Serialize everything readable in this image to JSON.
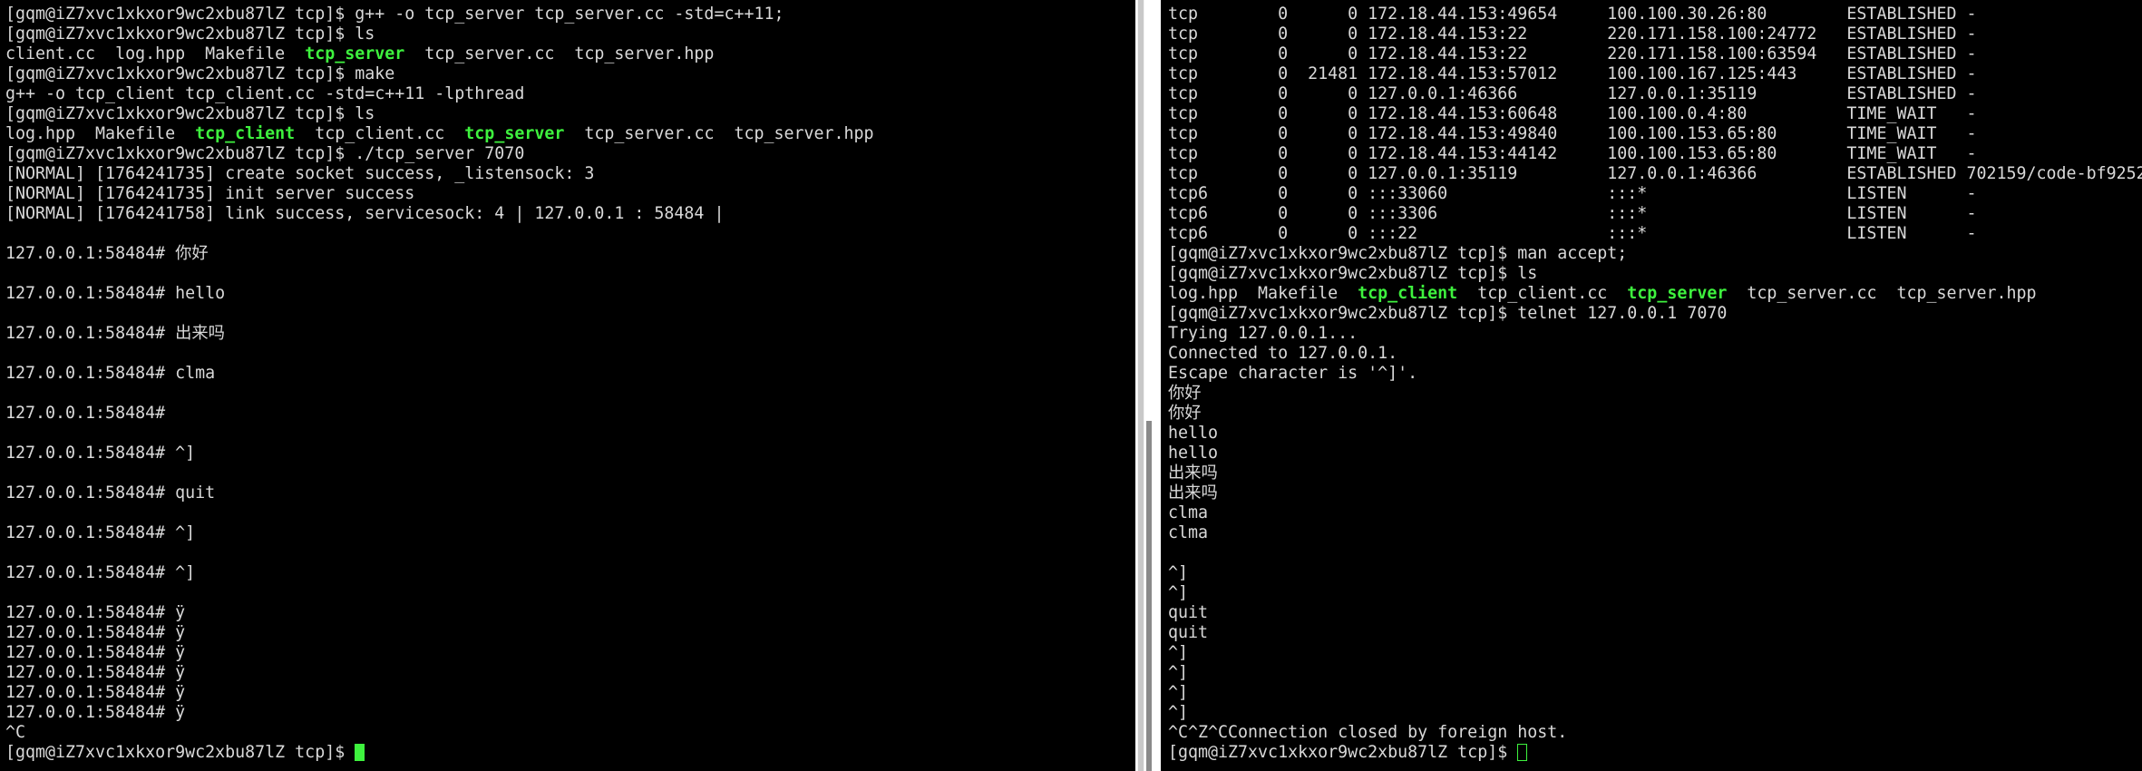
{
  "colors": {
    "background": "#000000",
    "text": "#d9d9d9",
    "executable": "#3ef23e",
    "cursor": "#3ef23e",
    "divider": "#ffffff"
  },
  "left_terminal": {
    "lines": [
      [
        {
          "t": "[gqm@iZ7xvc1xkxor9wc2xbu87lZ tcp]$ g++ -o tcp_server tcp_server.cc -std=c++11;",
          "k": "normal"
        }
      ],
      [
        {
          "t": "[gqm@iZ7xvc1xkxor9wc2xbu87lZ tcp]$ ls",
          "k": "normal"
        }
      ],
      [
        {
          "t": "client.cc  log.hpp  Makefile  ",
          "k": "normal"
        },
        {
          "t": "tcp_server",
          "k": "exec"
        },
        {
          "t": "  tcp_server.cc  tcp_server.hpp",
          "k": "normal"
        }
      ],
      [
        {
          "t": "[gqm@iZ7xvc1xkxor9wc2xbu87lZ tcp]$ make",
          "k": "normal"
        }
      ],
      [
        {
          "t": "g++ -o tcp_client tcp_client.cc -std=c++11 -lpthread",
          "k": "normal"
        }
      ],
      [
        {
          "t": "[gqm@iZ7xvc1xkxor9wc2xbu87lZ tcp]$ ls",
          "k": "normal"
        }
      ],
      [
        {
          "t": "log.hpp  Makefile  ",
          "k": "normal"
        },
        {
          "t": "tcp_client",
          "k": "exec"
        },
        {
          "t": "  tcp_client.cc  ",
          "k": "normal"
        },
        {
          "t": "tcp_server",
          "k": "exec"
        },
        {
          "t": "  tcp_server.cc  tcp_server.hpp",
          "k": "normal"
        }
      ],
      [
        {
          "t": "[gqm@iZ7xvc1xkxor9wc2xbu87lZ tcp]$ ./tcp_server 7070",
          "k": "normal"
        }
      ],
      [
        {
          "t": "[NORMAL] [1764241735] create socket success, _listensock: 3",
          "k": "normal"
        }
      ],
      [
        {
          "t": "[NORMAL] [1764241735] init server success",
          "k": "normal"
        }
      ],
      [
        {
          "t": "[NORMAL] [1764241758] link success, servicesock: 4 | 127.0.0.1 : 58484 |",
          "k": "normal"
        }
      ],
      [
        {
          "t": "",
          "k": "normal"
        }
      ],
      [
        {
          "t": "127.0.0.1:58484# 你好",
          "k": "normal"
        }
      ],
      [
        {
          "t": "",
          "k": "normal"
        }
      ],
      [
        {
          "t": "127.0.0.1:58484# hello",
          "k": "normal"
        }
      ],
      [
        {
          "t": "",
          "k": "normal"
        }
      ],
      [
        {
          "t": "127.0.0.1:58484# 出来吗",
          "k": "normal"
        }
      ],
      [
        {
          "t": "",
          "k": "normal"
        }
      ],
      [
        {
          "t": "127.0.0.1:58484# clma",
          "k": "normal"
        }
      ],
      [
        {
          "t": "",
          "k": "normal"
        }
      ],
      [
        {
          "t": "127.0.0.1:58484#",
          "k": "normal"
        }
      ],
      [
        {
          "t": "",
          "k": "normal"
        }
      ],
      [
        {
          "t": "127.0.0.1:58484# ^]",
          "k": "normal"
        }
      ],
      [
        {
          "t": "",
          "k": "normal"
        }
      ],
      [
        {
          "t": "127.0.0.1:58484# quit",
          "k": "normal"
        }
      ],
      [
        {
          "t": "",
          "k": "normal"
        }
      ],
      [
        {
          "t": "127.0.0.1:58484# ^]",
          "k": "normal"
        }
      ],
      [
        {
          "t": "",
          "k": "normal"
        }
      ],
      [
        {
          "t": "127.0.0.1:58484# ^]",
          "k": "normal"
        }
      ],
      [
        {
          "t": "",
          "k": "normal"
        }
      ],
      [
        {
          "t": "127.0.0.1:58484# ÿ",
          "k": "normal"
        }
      ],
      [
        {
          "t": "127.0.0.1:58484# ÿ",
          "k": "normal"
        }
      ],
      [
        {
          "t": "127.0.0.1:58484# ÿ",
          "k": "normal"
        }
      ],
      [
        {
          "t": "127.0.0.1:58484# ÿ",
          "k": "normal"
        }
      ],
      [
        {
          "t": "127.0.0.1:58484# ÿ",
          "k": "normal"
        }
      ],
      [
        {
          "t": "127.0.0.1:58484# ÿ",
          "k": "normal"
        }
      ],
      [
        {
          "t": "^C",
          "k": "normal"
        }
      ],
      [
        {
          "t": "[gqm@iZ7xvc1xkxor9wc2xbu87lZ tcp]$ ",
          "k": "normal"
        },
        {
          "t": "",
          "k": "cursor-block"
        }
      ]
    ]
  },
  "right_terminal": {
    "lines": [
      [
        {
          "t": "tcp        0      0 172.18.44.153:49654     100.100.30.26:80        ESTABLISHED -",
          "k": "normal"
        }
      ],
      [
        {
          "t": "tcp        0      0 172.18.44.153:22        220.171.158.100:24772   ESTABLISHED -",
          "k": "normal"
        }
      ],
      [
        {
          "t": "tcp        0      0 172.18.44.153:22        220.171.158.100:63594   ESTABLISHED -",
          "k": "normal"
        }
      ],
      [
        {
          "t": "tcp        0  21481 172.18.44.153:57012     100.100.167.125:443     ESTABLISHED -",
          "k": "normal"
        }
      ],
      [
        {
          "t": "tcp        0      0 127.0.0.1:46366         127.0.0.1:35119         ESTABLISHED -",
          "k": "normal"
        }
      ],
      [
        {
          "t": "tcp        0      0 172.18.44.153:60648     100.100.0.4:80          TIME_WAIT   -",
          "k": "normal"
        }
      ],
      [
        {
          "t": "tcp        0      0 172.18.44.153:49840     100.100.153.65:80       TIME_WAIT   -",
          "k": "normal"
        }
      ],
      [
        {
          "t": "tcp        0      0 172.18.44.153:44142     100.100.153.65:80       TIME_WAIT   -",
          "k": "normal"
        }
      ],
      [
        {
          "t": "tcp        0      0 127.0.0.1:35119         127.0.0.1:46366         ESTABLISHED 702159/code-bf9252",
          "k": "normal"
        }
      ],
      [
        {
          "t": "tcp6       0      0 :::33060                :::*                    LISTEN      -",
          "k": "normal"
        }
      ],
      [
        {
          "t": "tcp6       0      0 :::3306                 :::*                    LISTEN      -",
          "k": "normal"
        }
      ],
      [
        {
          "t": "tcp6       0      0 :::22                   :::*                    LISTEN      -",
          "k": "normal"
        }
      ],
      [
        {
          "t": "[gqm@iZ7xvc1xkxor9wc2xbu87lZ tcp]$ man accept;",
          "k": "normal"
        }
      ],
      [
        {
          "t": "[gqm@iZ7xvc1xkxor9wc2xbu87lZ tcp]$ ls",
          "k": "normal"
        }
      ],
      [
        {
          "t": "log.hpp  Makefile  ",
          "k": "normal"
        },
        {
          "t": "tcp_client",
          "k": "exec"
        },
        {
          "t": "  tcp_client.cc  ",
          "k": "normal"
        },
        {
          "t": "tcp_server",
          "k": "exec"
        },
        {
          "t": "  tcp_server.cc  tcp_server.hpp",
          "k": "normal"
        }
      ],
      [
        {
          "t": "[gqm@iZ7xvc1xkxor9wc2xbu87lZ tcp]$ telnet 127.0.0.1 7070",
          "k": "normal"
        }
      ],
      [
        {
          "t": "Trying 127.0.0.1...",
          "k": "normal"
        }
      ],
      [
        {
          "t": "Connected to 127.0.0.1.",
          "k": "normal"
        }
      ],
      [
        {
          "t": "Escape character is '^]'.",
          "k": "normal"
        }
      ],
      [
        {
          "t": "你好",
          "k": "normal"
        }
      ],
      [
        {
          "t": "你好",
          "k": "normal"
        }
      ],
      [
        {
          "t": "hello",
          "k": "normal"
        }
      ],
      [
        {
          "t": "hello",
          "k": "normal"
        }
      ],
      [
        {
          "t": "出来吗",
          "k": "normal"
        }
      ],
      [
        {
          "t": "出来吗",
          "k": "normal"
        }
      ],
      [
        {
          "t": "clma",
          "k": "normal"
        }
      ],
      [
        {
          "t": "clma",
          "k": "normal"
        }
      ],
      [
        {
          "t": "",
          "k": "normal"
        }
      ],
      [
        {
          "t": "^]",
          "k": "normal"
        }
      ],
      [
        {
          "t": "^]",
          "k": "normal"
        }
      ],
      [
        {
          "t": "quit",
          "k": "normal"
        }
      ],
      [
        {
          "t": "quit",
          "k": "normal"
        }
      ],
      [
        {
          "t": "^]",
          "k": "normal"
        }
      ],
      [
        {
          "t": "^]",
          "k": "normal"
        }
      ],
      [
        {
          "t": "^]",
          "k": "normal"
        }
      ],
      [
        {
          "t": "^]",
          "k": "normal"
        }
      ],
      [
        {
          "t": "^C^Z^CConnection closed by foreign host.",
          "k": "normal"
        }
      ],
      [
        {
          "t": "[gqm@iZ7xvc1xkxor9wc2xbu87lZ tcp]$ ",
          "k": "normal"
        },
        {
          "t": "",
          "k": "cursor-hollow"
        }
      ]
    ]
  }
}
